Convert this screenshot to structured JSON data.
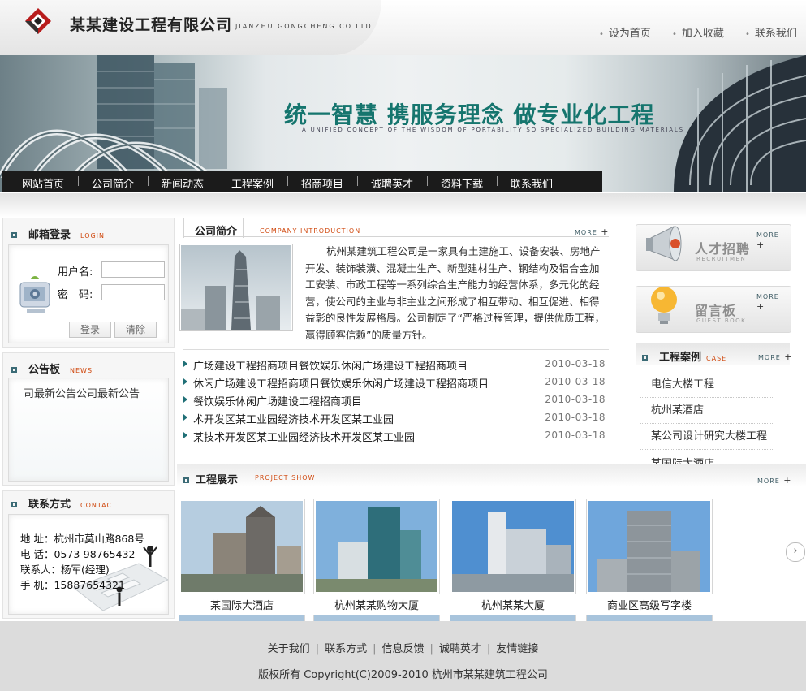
{
  "header": {
    "company_name": "某某建设工程有限公司",
    "company_en": "JIANZHU  GONGCHENG CO.LTD.",
    "links": [
      "设为首页",
      "加入收藏",
      "联系我们"
    ]
  },
  "banner": {
    "slogan": "统一智慧  携服务理念 做专业化工程",
    "slogan_en": "A UNIFIED CONCEPT OF THE WISDOM OF PORTABILITY SO SPECIALIZED BUILDING MATERIALS"
  },
  "nav": [
    "网站首页",
    "公司简介",
    "新闻动态",
    "工程案例",
    "招商项目",
    "诚聘英才",
    "资料下载",
    "联系我们"
  ],
  "login": {
    "title": "邮箱登录",
    "title_en": "LOGIN",
    "username_label": "用户名:",
    "password_label": "密　码:",
    "login_button": "登录",
    "clear_button": "清除"
  },
  "notice": {
    "title": "公告板",
    "title_en": "NEWS",
    "text": "司最新公告公司最新公告"
  },
  "contact": {
    "title": "联系方式",
    "title_en": "CONTACT",
    "lines": [
      "地 址：杭州市莫山路868号",
      "电 话：0573-98765432",
      "联系人：杨军(经理)",
      "手 机：15887654321"
    ]
  },
  "intro": {
    "tab": "公司简介",
    "tab_en": "COMPANY INTRODUCTION",
    "more": "MORE",
    "text": "杭州某建筑工程公司是一家具有土建施工、设备安装、房地产开发、装饰装潢、混凝土生产、新型建材生产、钢结构及铝合金加工安装、市政工程等一系列综合生产能力的经营体系，多元化的经营，使公司的主业与非主业之间形成了相互带动、相互促进、相得益彰的良性发展格局。公司制定了“严格过程管理，提供优质工程，赢得顾客信赖”的质量方针。"
  },
  "news": [
    {
      "title": "广场建设工程招商项目餐饮娱乐休闲广场建设工程招商项目",
      "date": "2010-03-18"
    },
    {
      "title": "休闲广场建设工程招商项目餐饮娱乐休闲广场建设工程招商项目",
      "date": "2010-03-18"
    },
    {
      "title": "餐饮娱乐休闲广场建设工程招商项目",
      "date": "2010-03-18"
    },
    {
      "title": "术开发区某工业园经济技术开发区某工业园",
      "date": "2010-03-18"
    },
    {
      "title": "某技术开发区某工业园经济技术开发区某工业园",
      "date": "2010-03-18"
    }
  ],
  "showcase": {
    "title": "工程展示",
    "title_en": "PROJECT SHOW",
    "more": "MORE",
    "items": [
      "某国际大酒店",
      "杭州某某购物大厦",
      "杭州某某大厦",
      "商业区高级写字楼"
    ]
  },
  "right": {
    "recruit_title": "人才招聘",
    "recruit_en": "RECRUITMENT",
    "guest_title": "留言板",
    "guest_en": "GUEST BOOK",
    "more": "MORE",
    "cases_title": "工程案例",
    "cases_en": "CASE",
    "cases": [
      "电信大楼工程",
      "杭州某酒店",
      "某公司设计研究大楼工程",
      "某国际大酒店"
    ]
  },
  "footer": {
    "links": [
      "关于我们",
      "联系方式",
      "信息反馈",
      "诚聘英才",
      "友情链接"
    ],
    "copyright": "版权所有  Copyright(C)2009-2010 杭州市某某建筑工程公司"
  },
  "colors": {
    "accent": "#15756e",
    "nav_bg": "#1b1b1b",
    "tag_en": "#d04a10"
  }
}
